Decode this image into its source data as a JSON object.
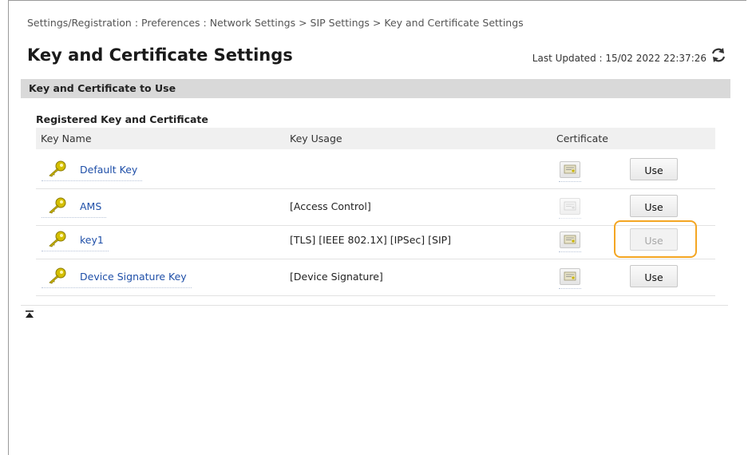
{
  "breadcrumb": "Settings/Registration : Preferences : Network Settings > SIP Settings > Key and Certificate Settings",
  "page_title": "Key and Certificate Settings",
  "last_updated_label": "Last Updated : 15/02 2022 22:37:26",
  "section_title": "Key and Certificate to Use",
  "subsection_title": "Registered Key and Certificate",
  "columns": {
    "key_name": "Key Name",
    "key_usage": "Key Usage",
    "certificate": "Certificate"
  },
  "rows": [
    {
      "key_name": "Default Key",
      "key_usage": "",
      "use_label": "Use",
      "use_enabled": true,
      "cert_enabled": true
    },
    {
      "key_name": "AMS",
      "key_usage": "[Access Control]",
      "use_label": "Use",
      "use_enabled": true,
      "cert_enabled": false
    },
    {
      "key_name": "key1",
      "key_usage": "[TLS] [IEEE 802.1X] [IPSec] [SIP]",
      "use_label": "Use",
      "use_enabled": false,
      "cert_enabled": true
    },
    {
      "key_name": "Device Signature Key",
      "key_usage": "[Device Signature]",
      "use_label": "Use",
      "use_enabled": true,
      "cert_enabled": true
    }
  ],
  "icons": {
    "refresh": "refresh-icon",
    "key": "key-icon",
    "certificate": "certificate-icon",
    "page_top": "page-top-icon"
  },
  "colors": {
    "link": "#1f4fa8",
    "highlight": "#f4a623",
    "section_bar": "#d9d9d9",
    "key_icon": "#c9b400"
  }
}
